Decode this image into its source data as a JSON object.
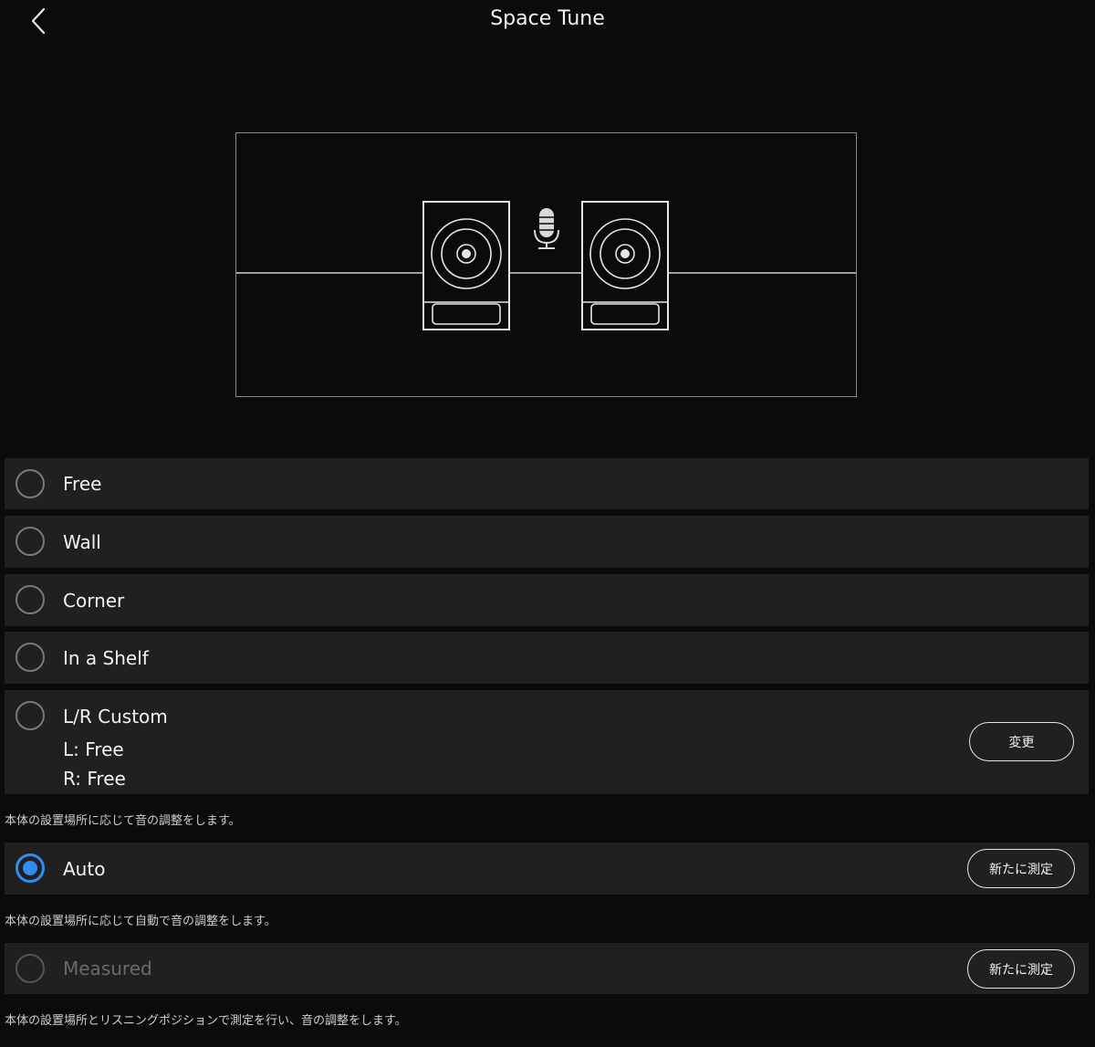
{
  "header": {
    "title": "Space Tune",
    "back_icon": "chevron-left-icon"
  },
  "illustration": {
    "left_speaker_icon": "speaker-icon",
    "microphone_icon": "microphone-icon",
    "right_speaker_icon": "speaker-icon"
  },
  "options": {
    "free": {
      "label": "Free",
      "selected": false
    },
    "wall": {
      "label": "Wall",
      "selected": false
    },
    "corner": {
      "label": "Corner",
      "selected": false
    },
    "shelf": {
      "label": "In a Shelf",
      "selected": false
    },
    "lr_custom": {
      "label": "L/R Custom",
      "left": "L: Free",
      "right": "R: Free",
      "button": "変更",
      "selected": false
    }
  },
  "manual_description": "本体の設置場所に応じて音の調整をします。",
  "auto": {
    "label": "Auto",
    "button": "新たに測定",
    "selected": true,
    "description": "本体の設置場所に応じて自動で音の調整をします。"
  },
  "measured": {
    "label": "Measured",
    "button": "新たに測定",
    "selected": false,
    "disabled": true,
    "description": "本体の設置場所とリスニングポジションで測定を行い、音の調整をします。"
  },
  "colors": {
    "accent": "#2f8df5",
    "row_background": "#202020",
    "page_background": "#0b0b0b"
  }
}
